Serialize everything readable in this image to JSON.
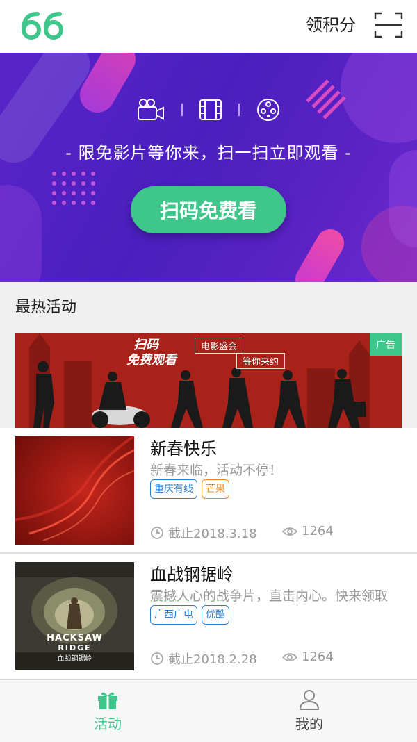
{
  "header": {
    "points_label": "领积分"
  },
  "banner": {
    "tagline": "- 限免影片等你来，扫一扫立即观看 -",
    "cta_label": "扫码免费看",
    "icons": [
      "video-camera-icon",
      "film-strip-icon",
      "film-reel-icon"
    ]
  },
  "section": {
    "title": "最热活动"
  },
  "ad": {
    "badge": "广告",
    "title_line1": "扫码",
    "title_line2": "免费观看",
    "tag1": "电影盛会",
    "tag2": "等你来约"
  },
  "items": [
    {
      "title": "新春快乐",
      "desc": "新春来临，活动不停！",
      "tags": [
        {
          "label": "重庆有线",
          "color": "#2b7fd4"
        },
        {
          "label": "芒果",
          "color": "#f08a1c"
        }
      ],
      "deadline": "截止2018.3.18",
      "views": "1264"
    },
    {
      "title": "血战钢锯岭",
      "desc": "震撼人心的战争片，直击内心。快来领取",
      "tags": [
        {
          "label": "广西广电",
          "color": "#2b7fd4"
        },
        {
          "label": "优酷",
          "color": "#2b7fd4"
        }
      ],
      "deadline": "截止2018.2.28",
      "views": "1264",
      "poster_text1": "HACKSAW",
      "poster_text2": "RIDGE",
      "poster_text3": "血战钢锯岭"
    }
  ],
  "tabbar": {
    "tabs": [
      {
        "label": "活动",
        "active": true
      },
      {
        "label": "我的",
        "active": false
      }
    ]
  },
  "colors": {
    "accent": "#3fc68a",
    "banner": "#4b1fbf",
    "ad_red": "#a82219"
  }
}
